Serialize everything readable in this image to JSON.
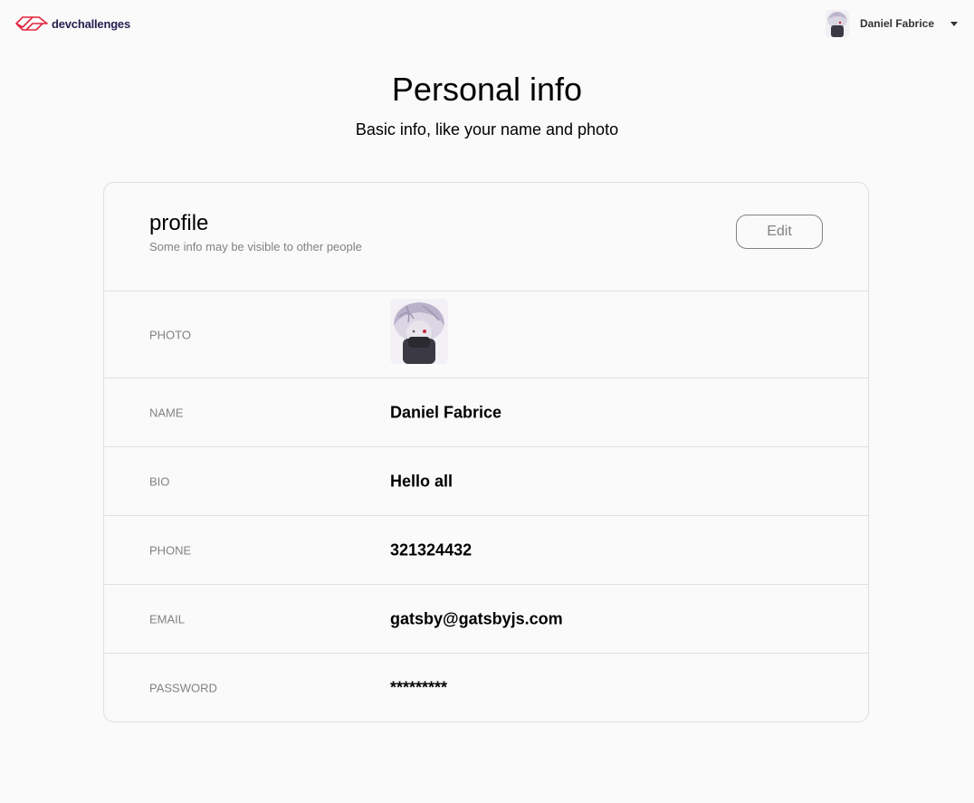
{
  "header": {
    "logo_text": "devchallenges",
    "user_name": "Daniel Fabrice"
  },
  "page": {
    "title": "Personal info",
    "subtitle": "Basic info, like your name and photo"
  },
  "profile": {
    "title": "profile",
    "subtitle": "Some info may be visible to other people",
    "edit_label": "Edit",
    "rows": [
      {
        "label": "PHOTO",
        "value": ""
      },
      {
        "label": "NAME",
        "value": "Daniel Fabrice"
      },
      {
        "label": "BIO",
        "value": "Hello all"
      },
      {
        "label": "PHONE",
        "value": "321324432"
      },
      {
        "label": "EMAIL",
        "value": "gatsby@gatsbyjs.com"
      },
      {
        "label": "PASSWORD",
        "value": "*********"
      }
    ]
  },
  "colors": {
    "background": "#fafafa",
    "border": "#e0e0e0",
    "muted_text": "#828282",
    "logo_red": "#e2263f",
    "logo_text": "#282051"
  },
  "icons": {
    "logo": "devchallenges-logo-icon",
    "dropdown": "caret-down-icon"
  }
}
